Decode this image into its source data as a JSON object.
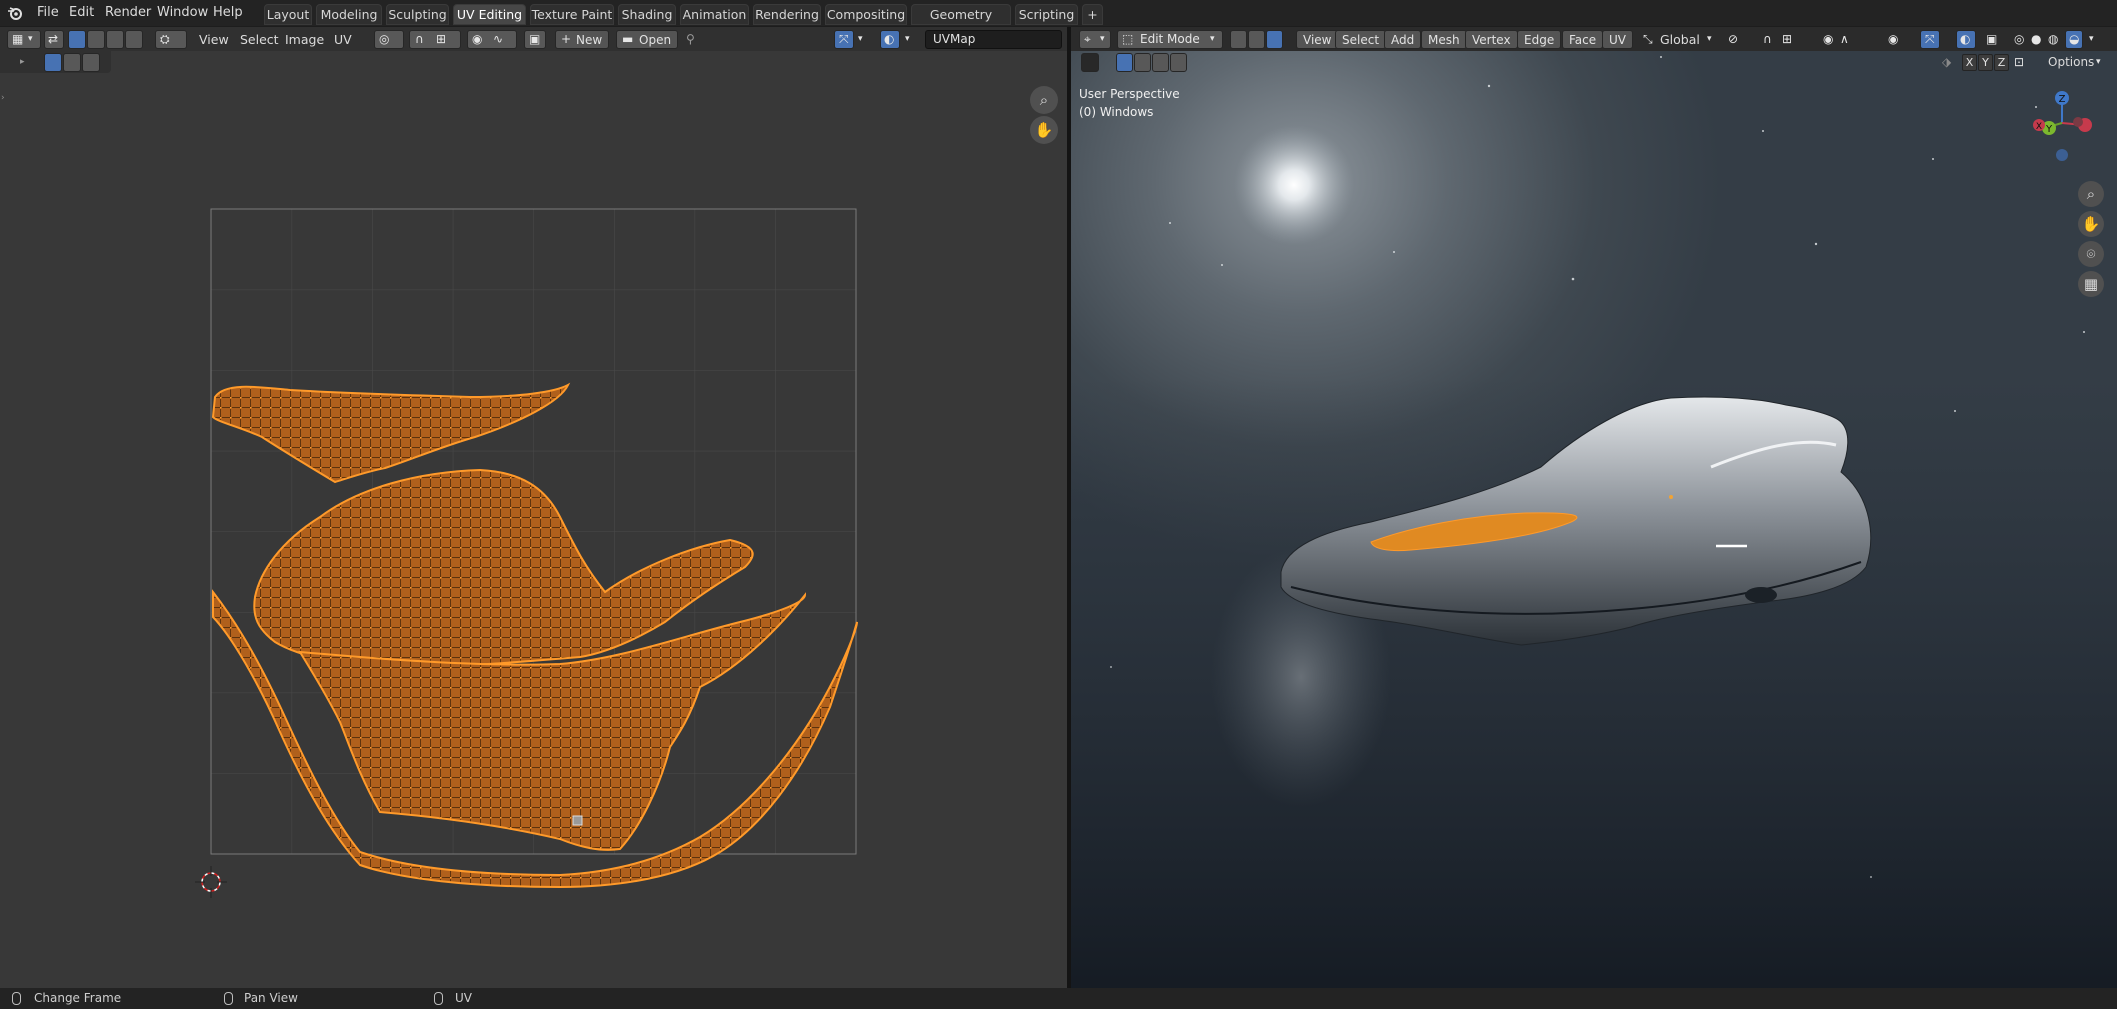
{
  "menus": [
    "File",
    "Edit",
    "Render",
    "Window",
    "Help"
  ],
  "workspace_tabs": [
    {
      "label": "Layout",
      "active": false
    },
    {
      "label": "Modeling",
      "active": false
    },
    {
      "label": "Sculpting",
      "active": false
    },
    {
      "label": "UV Editing",
      "active": true
    },
    {
      "label": "Texture Paint",
      "active": false
    },
    {
      "label": "Shading",
      "active": false
    },
    {
      "label": "Animation",
      "active": false
    },
    {
      "label": "Rendering",
      "active": false
    },
    {
      "label": "Compositing",
      "active": false
    },
    {
      "label": "Geometry Nodes",
      "active": false
    },
    {
      "label": "Scripting",
      "active": false
    }
  ],
  "add_workspace_glyph": "+",
  "uv_header": {
    "menus": [
      "View",
      "Select",
      "Image",
      "UV"
    ],
    "new_label": "New",
    "open_label": "Open",
    "uv_map_name": "UVMap",
    "editor_type_icon": "uv-editor-icon"
  },
  "viewport_header": {
    "mode_label": "Edit Mode",
    "menus": [
      "View",
      "Select",
      "Add",
      "Mesh",
      "Vertex",
      "Edge",
      "Face",
      "UV"
    ],
    "transform_orientation": "Global",
    "options_label": "Options",
    "axes": [
      "X",
      "Y",
      "Z"
    ]
  },
  "viewport_overlay": {
    "perspective": "User Perspective",
    "collection": "(0) Windows"
  },
  "gizmo_labels": {
    "z": "Z",
    "y": "Y",
    "x": "X"
  },
  "status_bar": [
    {
      "label": "Change Frame",
      "icon": "mouse-left-icon"
    },
    {
      "label": "Pan View",
      "icon": "mouse-middle-icon"
    },
    {
      "label": "UV",
      "icon": "mouse-right-icon"
    }
  ],
  "colors": {
    "accent_blue": "#4772b3",
    "uv_island_fill": "#c46a1e",
    "uv_edge": "#ff8c1a",
    "active_tab": "#474747"
  }
}
